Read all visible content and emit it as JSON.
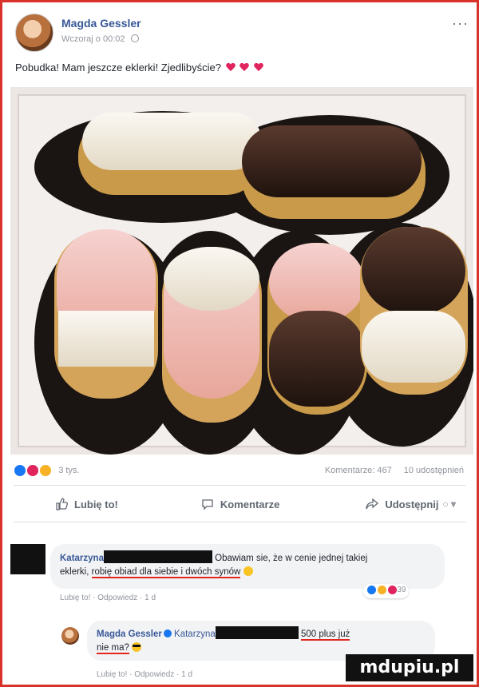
{
  "post": {
    "author": "Magda Gessler",
    "timestamp": "Wczoraj o 00:02",
    "text": "Pobudka! Mam jeszcze eklerki! Zjedlibyście?",
    "more_icon": "ellipsis-icon",
    "privacy_icon": "globe-icon"
  },
  "stats": {
    "reactions": "3 tys.",
    "comments": "Komentarze: 467",
    "shares": "10 udostępnień"
  },
  "actions": {
    "like": "Lubię to!",
    "comment": "Komentarze",
    "share": "Udostępnij"
  },
  "comments": [
    {
      "name": "Katarzyna",
      "text_a": "Obawiam sie, że w cenie jednej takiej",
      "text_b": "eklerki, ",
      "text_c": "robię obiad dla siebie i dwóch synów",
      "meta": "Lubię to! · Odpowiedz · 1 d",
      "reaction_count": "39"
    },
    {
      "name": "Magda Gessler",
      "mention": "Katarzyna",
      "text_a": "500 plus już",
      "text_b": "nie ma?",
      "meta": "Lubię to! · Odpowiedz · 1 d"
    }
  ],
  "colors": {
    "link": "#385898",
    "frame": "#d9322b",
    "underline": "#e3271f",
    "like": "#1877f2",
    "love": "#e0245e"
  },
  "watermark": "mdupiu.pl"
}
